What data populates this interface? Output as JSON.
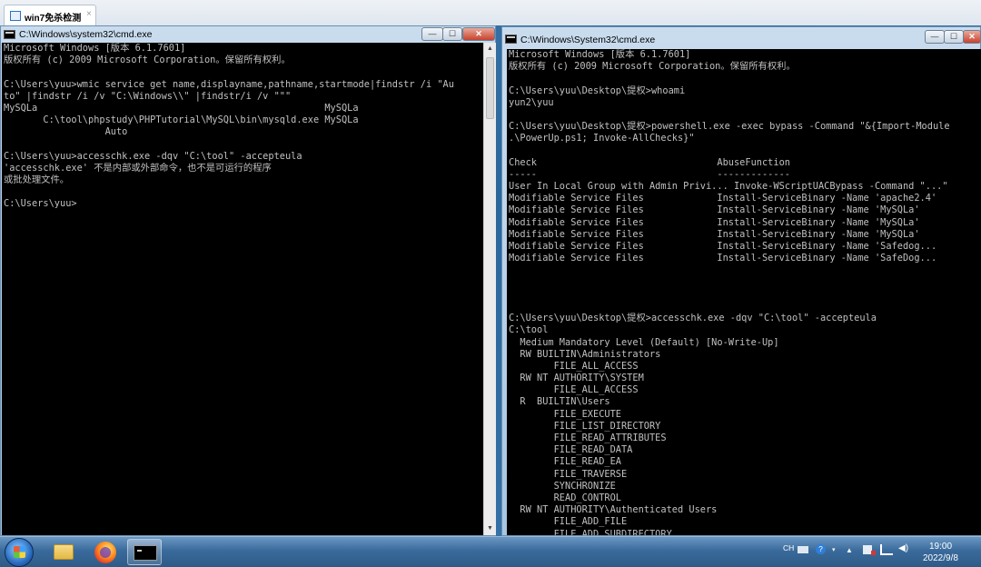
{
  "tab": {
    "title": "win7免杀检测",
    "close": "×"
  },
  "left_window": {
    "title": "C:\\Windows\\system32\\cmd.exe",
    "buttons": {
      "minimize": "—",
      "maximize": "☐",
      "close": "✕"
    },
    "lines": [
      "Microsoft Windows [版本 6.1.7601]",
      "版权所有 (c) 2009 Microsoft Corporation。保留所有权利。",
      "",
      "C:\\Users\\yuu>wmic service get name,displayname,pathname,startmode|findstr /i \"Au",
      "to\" |findstr /i /v \"C:\\Windows\\\\\" |findstr/i /v \"\"\"",
      "MySQLa                                                   MySQLa",
      "       C:\\tool\\phpstudy\\PHPTutorial\\MySQL\\bin\\mysqld.exe MySQLa",
      "                  Auto",
      "",
      "C:\\Users\\yuu>accesschk.exe -dqv \"C:\\tool\" -accepteula",
      "'accesschk.exe' 不是内部或外部命令，也不是可运行的程序",
      "或批处理文件。",
      "",
      "C:\\Users\\yuu>"
    ]
  },
  "right_window": {
    "title": "C:\\Windows\\System32\\cmd.exe",
    "buttons": {
      "minimize": "—",
      "maximize": "☐",
      "close": "✕"
    },
    "lines": [
      "Microsoft Windows [版本 6.1.7601]",
      "版权所有 (c) 2009 Microsoft Corporation。保留所有权利。",
      "",
      "C:\\Users\\yuu\\Desktop\\提权>whoami",
      "yun2\\yuu",
      "",
      "C:\\Users\\yuu\\Desktop\\提权>powershell.exe -exec bypass -Command \"&{Import-Module",
      ".\\PowerUp.ps1; Invoke-AllChecks}\"",
      "",
      "Check                                AbuseFunction",
      "-----                                -------------",
      "User In Local Group with Admin Privi... Invoke-WScriptUACBypass -Command \"...\"",
      "Modifiable Service Files             Install-ServiceBinary -Name 'apache2.4'",
      "Modifiable Service Files             Install-ServiceBinary -Name 'MySQLa'",
      "Modifiable Service Files             Install-ServiceBinary -Name 'MySQLa'",
      "Modifiable Service Files             Install-ServiceBinary -Name 'MySQLa'",
      "Modifiable Service Files             Install-ServiceBinary -Name 'Safedog...",
      "Modifiable Service Files             Install-ServiceBinary -Name 'SafeDog...",
      "",
      "",
      "",
      "",
      "C:\\Users\\yuu\\Desktop\\提权>accesschk.exe -dqv \"C:\\tool\" -accepteula",
      "C:\\tool",
      "  Medium Mandatory Level (Default) [No-Write-Up]",
      "  RW BUILTIN\\Administrators",
      "        FILE_ALL_ACCESS",
      "  RW NT AUTHORITY\\SYSTEM",
      "        FILE_ALL_ACCESS",
      "  R  BUILTIN\\Users",
      "        FILE_EXECUTE",
      "        FILE_LIST_DIRECTORY",
      "        FILE_READ_ATTRIBUTES",
      "        FILE_READ_DATA",
      "        FILE_READ_EA",
      "        FILE_TRAVERSE",
      "        SYNCHRONIZE",
      "        READ_CONTROL",
      "  RW NT AUTHORITY\\Authenticated Users",
      "        FILE_ADD_FILE",
      "        FILE_ADD_SUBDIRECTORY"
    ]
  },
  "taskbar": {
    "apps": [
      "start-orb",
      "explorer",
      "firefox",
      "cmd"
    ],
    "tray": {
      "lang": "CH",
      "help": "?",
      "time": "19:00",
      "date": "2022/9/8"
    }
  }
}
